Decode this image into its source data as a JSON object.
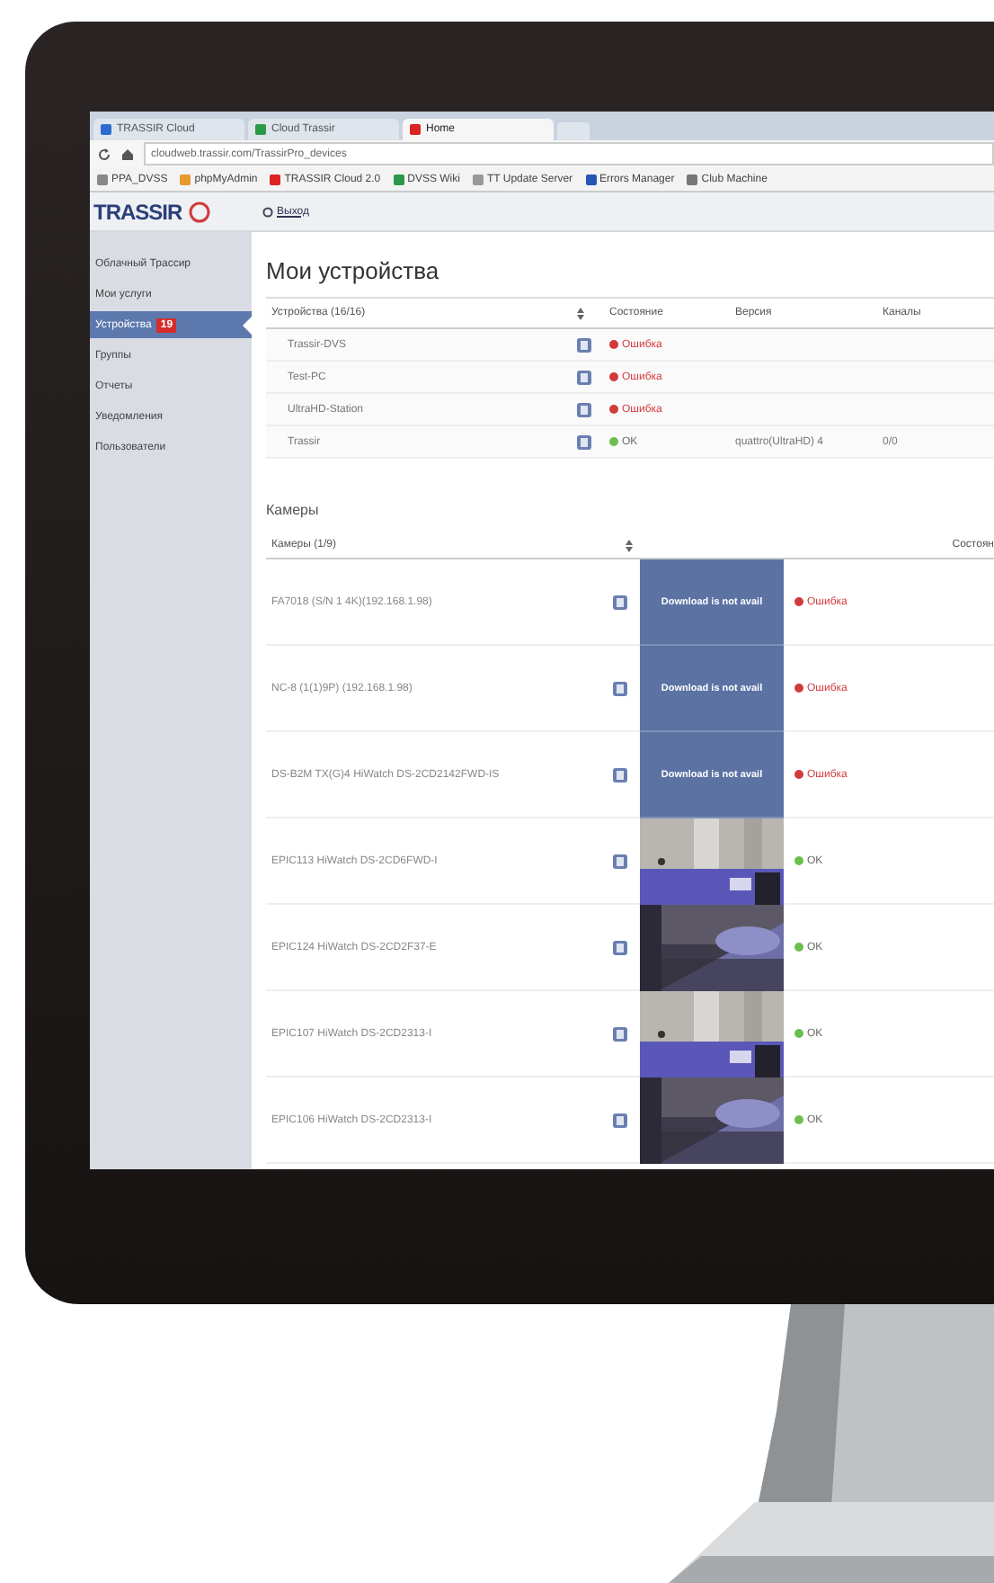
{
  "browser": {
    "tabs": [
      {
        "label": "TRASSIR Cloud",
        "selected": false
      },
      {
        "label": "Cloud Trassir",
        "selected": false
      },
      {
        "label": "Home",
        "selected": true
      }
    ],
    "address": "cloudweb.trassir.com/TrassirPro_devices",
    "bookmarks": [
      "PPA_DVSS",
      "phpMyAdmin",
      "TRASSIR Cloud 2.0",
      "DVSS Wiki",
      "TT Update Server",
      "Errors Manager",
      "Club Machine"
    ]
  },
  "header": {
    "logo": "TRASSIR",
    "logout": "Выход"
  },
  "sidebar": {
    "items": [
      {
        "label": "Облачный Трассир",
        "selected": false
      },
      {
        "label": "Мои услуги",
        "selected": false
      },
      {
        "label": "Устройства",
        "selected": true,
        "badge": "19"
      },
      {
        "label": "Группы",
        "selected": false
      },
      {
        "label": "Отчеты",
        "selected": false
      },
      {
        "label": "Уведомления",
        "selected": false
      },
      {
        "label": "Пользователи",
        "selected": false
      }
    ]
  },
  "devices": {
    "title": "Мои устройства",
    "columns": [
      "Устройства (16/16)",
      "Состояние",
      "Версия",
      "Каналы"
    ],
    "rows": [
      {
        "name": "Trassir-DVS",
        "error": true,
        "status": "Ошибка"
      },
      {
        "name": "Test-PC",
        "error": true,
        "status": "Ошибка"
      },
      {
        "name": "UltraHD-Station",
        "error": true,
        "status": "Ошибка"
      },
      {
        "name": "Trassir",
        "error": false,
        "status": "OK",
        "version": "quattro(UltraHD) 4",
        "channels": "0/0"
      }
    ]
  },
  "cameras": {
    "title": "Камеры",
    "columns": [
      "Камеры (1/9)",
      "Состоян"
    ],
    "rows": [
      {
        "name": "FA7018 (S/N 1 4K)(192.168.1.98)",
        "thumb": {
          "kind": "message",
          "text": "Download is not avail"
        },
        "error": true,
        "status": "Ошибка"
      },
      {
        "name": "NC-8 (1(1)9P) (192.168.1.98)",
        "thumb": {
          "kind": "message",
          "text": "Download is not avail"
        },
        "error": true,
        "status": "Ошибка"
      },
      {
        "name": "DS-B2M TX(G)4 HiWatch DS-2CD2142FWD-IS",
        "thumb": {
          "kind": "message",
          "text": "Download is not avail"
        },
        "error": true,
        "status": "Ошибка"
      },
      {
        "name": "EPIC113 HiWatch DS-2CD6FWD-I",
        "error": false,
        "status": "OK"
      },
      {
        "name": "EPIC124 HiWatch DS-2CD2F37-E",
        "error": false,
        "status": "OK"
      },
      {
        "name": "EPIC107 HiWatch DS-2CD2313-I",
        "error": false,
        "status": "OK"
      },
      {
        "name": "EPIC106 HiWatch DS-2CD2313-I",
        "error": false,
        "status": "OK"
      }
    ]
  }
}
